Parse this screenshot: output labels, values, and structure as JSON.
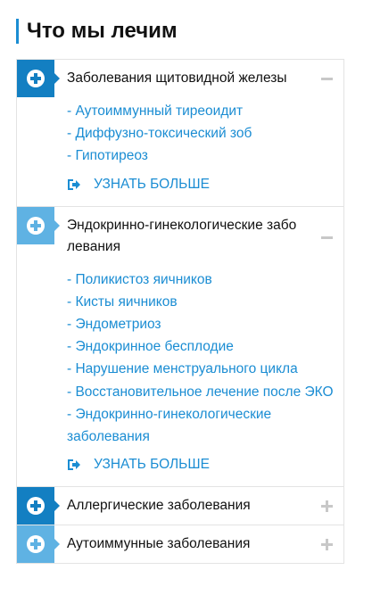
{
  "widget": {
    "title": "Что мы лечим",
    "colors": {
      "accent": "#1b8dd3",
      "tab_dark": "#137fc2",
      "tab_light": "#5fb2e3",
      "toggle": "#c8c8c8",
      "border": "#e3e3e3",
      "text": "#111111"
    }
  },
  "accordion": {
    "items": [
      {
        "title": "Заболевания щитовидной железы",
        "expanded": true,
        "icon": "plus-circle-icon",
        "toggle": "minus",
        "links": [
          "- Аутоиммунный тиреоидит",
          "- Диффузно-токсический зоб",
          "- Гипотиреоз"
        ],
        "more": "УЗНАТЬ БОЛЬШЕ"
      },
      {
        "title": "Эндокринно-гинекологические забо левания",
        "expanded": true,
        "icon": "plus-circle-icon",
        "toggle": "minus",
        "links": [
          "- Поликистоз яичников",
          "- Кисты яичников",
          "- Эндометриоз",
          "- Эндокринное бесплодие",
          "- Нарушение менструального цикла",
          "- Восстановительное лечение после ЭКО",
          "- Эндокринно-гинекологические заболевания"
        ],
        "more": "УЗНАТЬ БОЛЬШЕ"
      },
      {
        "title": "Аллергические заболевания",
        "expanded": false,
        "icon": "plus-circle-icon",
        "toggle": "plus"
      },
      {
        "title": "Аутоиммунные заболевания",
        "expanded": false,
        "icon": "plus-circle-icon",
        "toggle": "plus"
      }
    ]
  }
}
